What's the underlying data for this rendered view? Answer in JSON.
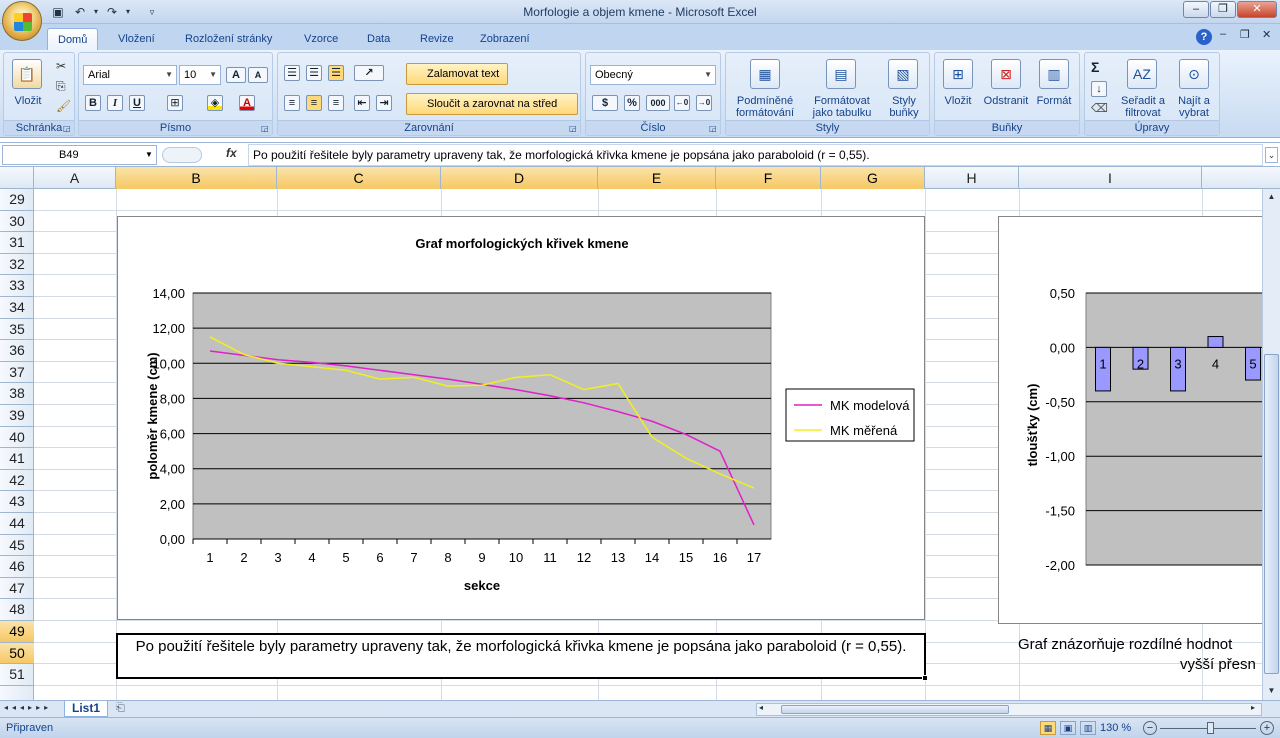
{
  "window": {
    "title": "Morfologie a objem kmene - Microsoft Excel"
  },
  "tabs": [
    "Domů",
    "Vložení",
    "Rozložení stránky",
    "Vzorce",
    "Data",
    "Revize",
    "Zobrazení"
  ],
  "ribbon": {
    "clipboard": {
      "label": "Schránka",
      "paste": "Vložit"
    },
    "font": {
      "label": "Písmo",
      "name": "Arial",
      "size": "10",
      "bold": "B",
      "italic": "I",
      "underline": "U"
    },
    "alignment": {
      "label": "Zarovnání",
      "wrap": "Zalamovat text",
      "merge": "Sloučit a zarovnat na střed"
    },
    "number": {
      "label": "Číslo",
      "format": "Obecný",
      "percent": "%",
      "thousands": "000"
    },
    "styles": {
      "label": "Styly",
      "cond1": "Podmíněné",
      "cond2": "formátování",
      "table1": "Formátovat",
      "table2": "jako tabulku",
      "cell1": "Styly",
      "cell2": "buňky"
    },
    "cells": {
      "label": "Buňky",
      "insert": "Vložit",
      "delete": "Odstranit",
      "format": "Formát"
    },
    "editing": {
      "label": "Úpravy",
      "sort1": "Seřadit a",
      "sort2": "filtrovat",
      "find1": "Najít a",
      "find2": "vybrat"
    }
  },
  "formula_bar": {
    "name_box": "B49",
    "fx": "fx",
    "formula": "Po použití řešitele byly parametry upraveny tak,  že morfologická křivka kmene je popsána jako paraboloid        (r = 0,55)."
  },
  "columns": [
    "A",
    "B",
    "C",
    "D",
    "E",
    "F",
    "G",
    "H",
    "I"
  ],
  "rows": [
    "29",
    "30",
    "31",
    "32",
    "33",
    "34",
    "35",
    "36",
    "37",
    "38",
    "39",
    "40",
    "41",
    "42",
    "43",
    "44",
    "45",
    "46",
    "47",
    "48",
    "49",
    "50",
    "51"
  ],
  "captions": {
    "main": "Po použití řešitele byly parametry upraveny tak,  že morfologická křivka kmene je popsána jako paraboloid (r = 0,55).",
    "right_line1": "Graf znázorňuje rozdílné hodnot",
    "right_line2": "vyšší přesn"
  },
  "sheet_tab": "List1",
  "status": {
    "ready": "Připraven",
    "zoom": "130 %"
  },
  "colors": {
    "model": "#e020c8",
    "measured": "#f0f020",
    "plot_bg": "#c0c0c0",
    "bar": "#9999ff"
  },
  "chart_data": [
    {
      "type": "line",
      "title": "Graf morfologických  křivek kmene",
      "xlabel": "sekce",
      "ylabel": "poloměr kmene (cm)",
      "x": [
        1,
        2,
        3,
        4,
        5,
        6,
        7,
        8,
        9,
        10,
        11,
        12,
        13,
        14,
        15,
        16,
        17
      ],
      "ylim": [
        0,
        14
      ],
      "yticks": [
        "0,00",
        "2,00",
        "4,00",
        "6,00",
        "8,00",
        "10,00",
        "12,00",
        "14,00"
      ],
      "legend_position": "right",
      "series": [
        {
          "name": "MK modelová",
          "values": [
            10.7,
            10.45,
            10.2,
            10.05,
            9.85,
            9.6,
            9.35,
            9.1,
            8.8,
            8.5,
            8.15,
            7.75,
            7.25,
            6.7,
            5.95,
            5.0,
            0.8
          ]
        },
        {
          "name": "MK měřená",
          "values": [
            11.5,
            10.5,
            10.0,
            9.8,
            9.6,
            9.1,
            9.2,
            8.7,
            8.75,
            9.2,
            9.35,
            8.5,
            8.85,
            5.8,
            4.6,
            3.7,
            2.9
          ]
        }
      ]
    },
    {
      "type": "bar",
      "ylabel": "tloušťky (cm)",
      "ylim": [
        -2,
        0.5
      ],
      "yticks": [
        "-2,00",
        "-1,50",
        "-1,00",
        "-0,50",
        "0,00",
        "0,50"
      ],
      "categories": [
        "1",
        "2",
        "3",
        "4",
        "5"
      ],
      "values": [
        -0.4,
        -0.2,
        -0.4,
        0.1,
        -0.3
      ]
    }
  ]
}
